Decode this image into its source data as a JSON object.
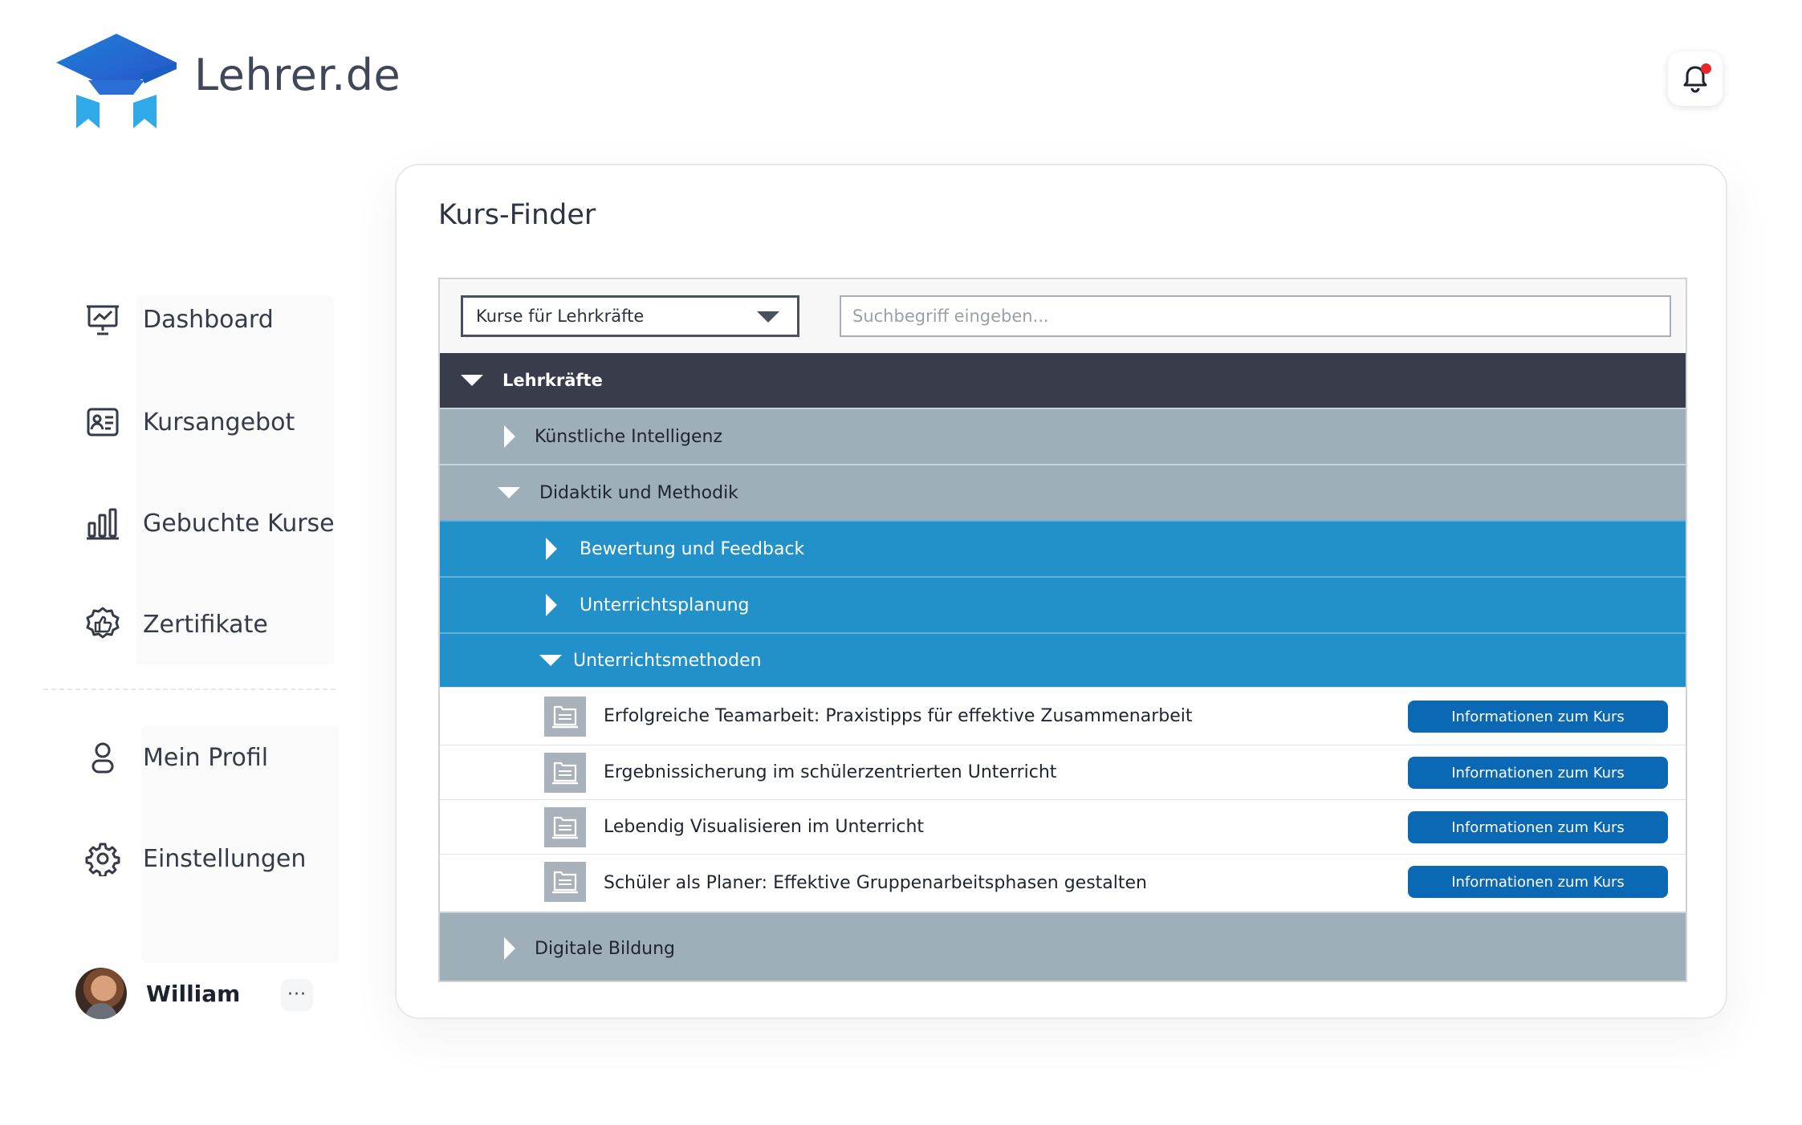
{
  "app": {
    "brand": "Lehrer.de"
  },
  "sidebar": {
    "items": [
      {
        "label": "Dashboard",
        "icon": "presentation-chart-icon"
      },
      {
        "label": "Kursangebot",
        "icon": "id-card-icon"
      },
      {
        "label": "Gebuchte Kurse",
        "icon": "bar-chart-icon"
      },
      {
        "label": "Zertifikate",
        "icon": "badge-thumbs-up-icon"
      },
      {
        "label": "Mein Profil",
        "icon": "user-icon"
      },
      {
        "label": "Einstellungen",
        "icon": "gear-icon"
      }
    ],
    "user": {
      "name": "William",
      "more": "···"
    }
  },
  "main": {
    "title": "Kurs-Finder",
    "filter": {
      "selected": "Kurse für Lehrkräfte"
    },
    "search": {
      "placeholder": "Suchbegriff eingeben..."
    },
    "tree": {
      "root": "Lehrkräfte",
      "ki": "Künstliche Intelligenz",
      "didaktik": "Didaktik und Methodik",
      "bewertung": "Bewertung und Feedback",
      "planung": "Unterrichtsplanung",
      "methoden": "Unterrichtsmethoden",
      "digital": "Digitale Bildung"
    },
    "courses": [
      {
        "title": "Erfolgreiche Teamarbeit: Praxistipps für effektive Zusammenarbeit",
        "button": "Informationen zum Kurs"
      },
      {
        "title": "Ergebnissicherung im schülerzentrierten Unterricht",
        "button": "Informationen zum Kurs"
      },
      {
        "title": "Lebendig Visualisieren im Unterricht",
        "button": "Informationen zum Kurs"
      },
      {
        "title": "Schüler als Planer: Effektive Gruppenarbeitsphasen gestalten",
        "button": "Informationen zum Kurs"
      }
    ]
  },
  "colors": {
    "accent": "#2391c9",
    "dark_row": "#383c4b",
    "gray_row": "#9eafba",
    "button": "#0b68b5",
    "notification_dot": "#e8262b"
  }
}
